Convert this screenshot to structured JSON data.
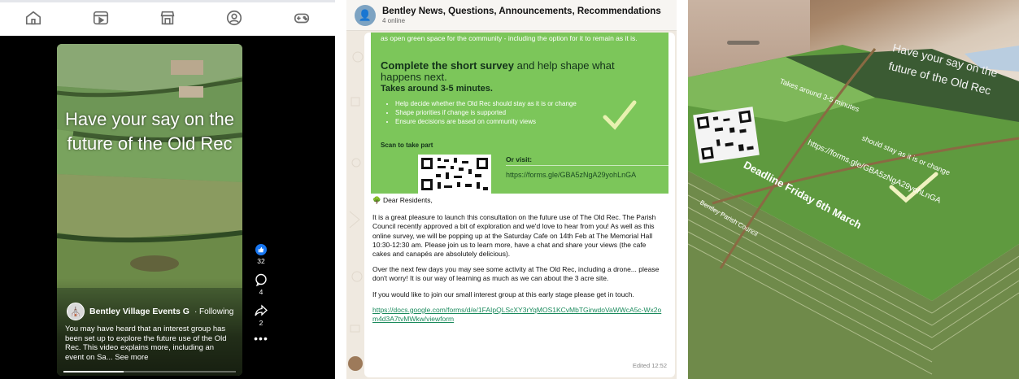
{
  "facebook_reel": {
    "nav": [
      {
        "name": "home-icon"
      },
      {
        "name": "video-icon"
      },
      {
        "name": "marketplace-icon"
      },
      {
        "name": "profile-icon"
      },
      {
        "name": "gaming-icon"
      }
    ],
    "overlay_title": "Have your say on the future of the Old Rec",
    "author": "Bentley Village Events G",
    "following": "· Following",
    "caption": "You may have heard that an interest group has been set up to explore the future use of the Old Rec. This video explains more, including an event on Sa... See more",
    "likes": "32",
    "comments": "4",
    "shares": "2",
    "more": "•••",
    "progress": 0.35
  },
  "whatsapp": {
    "group_title": "Bentley News, Questions, Announcements, Recommendations",
    "group_subtitle": "4 online",
    "poster": {
      "top_text": "as open green space for the community - including the option for it to remain as it is.",
      "headline_bold": "Complete the short survey",
      "headline_rest": " and help shape what happens next.",
      "duration": "Takes around 3-5 minutes.",
      "bullets": [
        "Help decide whether the Old Rec should stay as it is or change",
        "Shape priorities if change is supported",
        "Ensure decisions are based on community views"
      ],
      "scan": "Scan to take part",
      "or_visit": "Or visit:",
      "url": "https://forms.gle/GBA5zNgA29yohLnGA"
    },
    "greeting": "🌳 Dear Residents,",
    "para1": "It is a great pleasure to launch this consultation on the future use of The Old Rec. The Parish Council recently approved a bit of exploration and we'd love to hear from you! As well as this online survey, we will be popping up at the Saturday Cafe on 14th Feb at The Memorial Hall 10:30-12:30 am. Please join us to learn more, have a chat and share your views (the cafe cakes and canapés are absolutely delicious).",
    "para2": "Over the next few days you may see some activity at The Old Rec, including a drone... please don't worry! It is our way of learning as much as we can about the 3 acre site.",
    "para3": "If you would like to join our small interest group at this early stage please get in touch.",
    "link": "https://docs.google.com/forms/d/e/1FAIpQLScXY3rYqMOS1KCvMbTGirwdoVaWWcA5c-Wx2om4d3A7tvMWkw/viewform",
    "edited": "Edited  12:52"
  },
  "photo": {
    "flyer_line1": "Have your say on the",
    "flyer_line2": "future of the Old Rec",
    "flyer_url": "https://forms.gle/GBA5zNgA29yohLnGA",
    "flyer_deadline": "Deadline Friday 6th March",
    "flyer_bullet": "should stay as it is or change",
    "flyer_sub": "Takes around 3-5 minutes",
    "flyer_org": "Bentley Parish Council"
  }
}
